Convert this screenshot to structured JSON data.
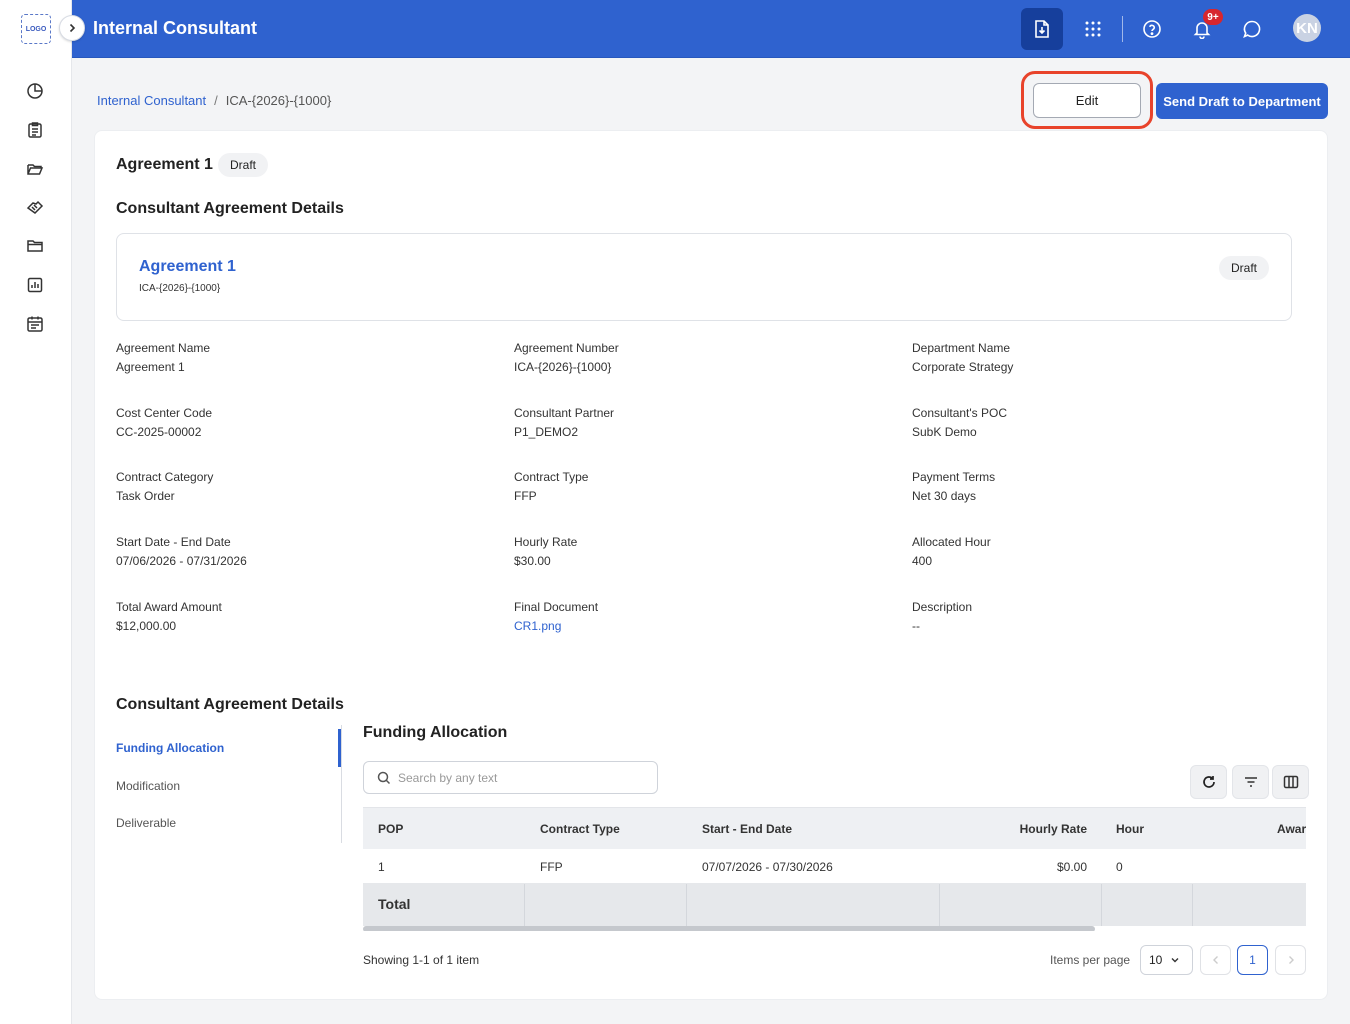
{
  "sidebar": {
    "logo_text": "LOGO",
    "nav_icons": [
      "pie-chart-icon",
      "clipboard-icon",
      "folder-open-icon",
      "handshake-icon",
      "folder-icon",
      "bar-chart-icon",
      "calendar-icon"
    ]
  },
  "header": {
    "title": "Internal Consultant",
    "notification_count": "9+",
    "avatar_initials": "KN"
  },
  "breadcrumb": {
    "root": "Internal Consultant",
    "separator": "/",
    "current": "ICA-{2026}-{1000}"
  },
  "actions": {
    "edit_label": "Edit",
    "send_label": "Send Draft to Department"
  },
  "agreement": {
    "title": "Agreement 1",
    "status": "Draft",
    "section_title": "Consultant Agreement Details",
    "summary": {
      "name": "Agreement 1",
      "number": "ICA-{2026}-{1000}",
      "status": "Draft"
    },
    "fields": [
      {
        "label": "Agreement Name",
        "value": "Agreement 1"
      },
      {
        "label": "Agreement Number",
        "value": "ICA-{2026}-{1000}"
      },
      {
        "label": "Department Name",
        "value": "Corporate Strategy"
      },
      {
        "label": "Cost Center Code",
        "value": "CC-2025-00002"
      },
      {
        "label": "Consultant Partner",
        "value": "P1_DEMO2"
      },
      {
        "label": "Consultant's POC",
        "value": "SubK Demo"
      },
      {
        "label": "Contract Category",
        "value": "Task Order"
      },
      {
        "label": "Contract Type",
        "value": "FFP"
      },
      {
        "label": "Payment Terms",
        "value": "Net 30 days"
      },
      {
        "label": "Start Date - End Date",
        "value": "07/06/2026 - 07/31/2026"
      },
      {
        "label": "Hourly Rate",
        "value": "$30.00"
      },
      {
        "label": "Allocated Hour",
        "value": "400"
      },
      {
        "label": "Total Award Amount",
        "value": "$12,000.00"
      },
      {
        "label": "Final Document",
        "value": "CR1.png"
      },
      {
        "label": "Description",
        "value": "--"
      }
    ]
  },
  "details": {
    "section_title": "Consultant Agreement Details",
    "tabs": [
      "Funding Allocation",
      "Modification",
      "Deliverable"
    ],
    "active_tab": "Funding Allocation",
    "funding": {
      "title": "Funding Allocation",
      "search_placeholder": "Search by any text",
      "columns": [
        "POP",
        "Contract Type",
        "Start - End Date",
        "Hourly Rate",
        "Hour",
        "Awar"
      ],
      "rows": [
        [
          "1",
          "FFP",
          "07/07/2026 - 07/30/2026",
          "$0.00",
          "0"
        ]
      ],
      "total_label": "Total"
    },
    "pagination": {
      "showing": "Showing 1-1 of 1 item",
      "items_per_page_label": "Items per page",
      "items_per_page": "10",
      "current_page": "1"
    }
  },
  "colors": {
    "primary": "#2f62cf",
    "highlight": "#e8432b",
    "badge": "#d7262e"
  }
}
